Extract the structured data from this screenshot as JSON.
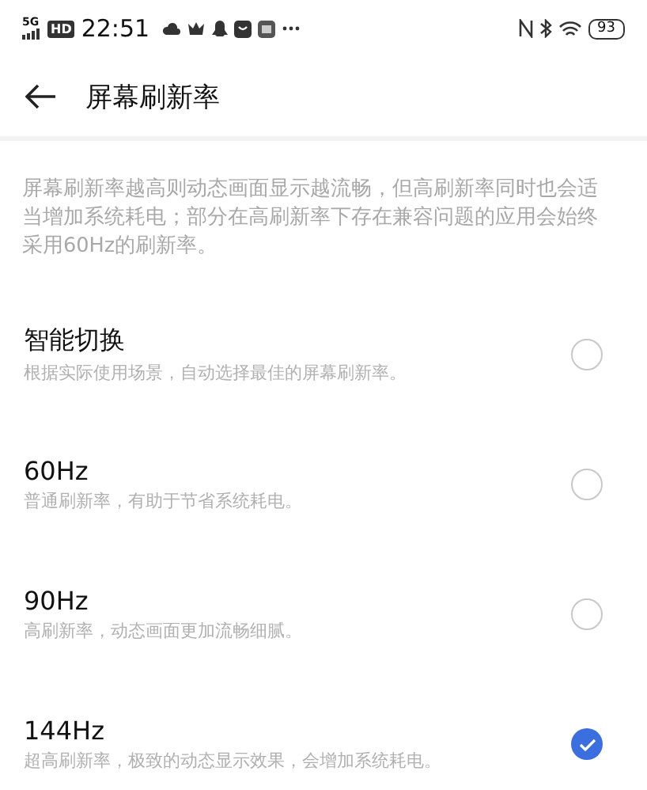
{
  "status_bar": {
    "network": "5G",
    "hd": "HD",
    "time": "22:51",
    "battery": "93"
  },
  "header": {
    "title": "屏幕刷新率"
  },
  "description": "屏幕刷新率越高则动态画面显示越流畅，但高刷新率同时也会适当增加系统耗电；部分在高刷新率下存在兼容问题的应用会始终采用60Hz的刷新率。",
  "options": [
    {
      "title": "智能切换",
      "subtitle": "根据实际使用场景，自动选择最佳的屏幕刷新率。",
      "selected": false
    },
    {
      "title": "60Hz",
      "subtitle": "普通刷新率，有助于节省系统耗电。",
      "selected": false
    },
    {
      "title": "90Hz",
      "subtitle": "高刷新率，动态画面更加流畅细腻。",
      "selected": false
    },
    {
      "title": "144Hz",
      "subtitle": "超高刷新率，极致的动态显示效果，会增加系统耗电。",
      "selected": true
    }
  ]
}
